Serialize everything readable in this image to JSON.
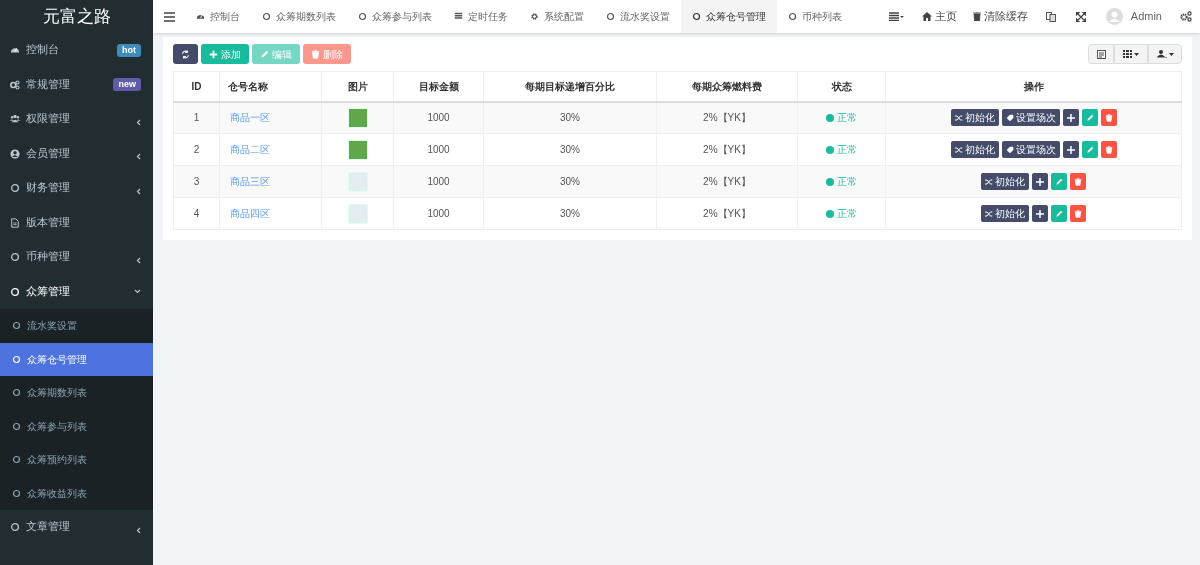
{
  "logo": "元富之路",
  "sidebar": {
    "items": [
      {
        "label": "控制台",
        "kind": "dashboard",
        "badge": {
          "text": "hot",
          "color": "#3c8dbc"
        }
      },
      {
        "label": "常规管理",
        "kind": "cogs",
        "badge": {
          "text": "new",
          "color": "#605ca8"
        }
      },
      {
        "label": "权限管理",
        "kind": "group",
        "expanded": false
      },
      {
        "label": "会员管理",
        "kind": "user",
        "expanded": false
      },
      {
        "label": "财务管理",
        "kind": "circle",
        "expanded": false
      },
      {
        "label": "版本管理",
        "kind": "file"
      },
      {
        "label": "币种管理",
        "kind": "circle",
        "expanded": false
      },
      {
        "label": "众筹管理",
        "kind": "circle",
        "expanded": true,
        "children": [
          {
            "label": "流水奖设置",
            "selected": false
          },
          {
            "label": "众筹仓号管理",
            "selected": true
          },
          {
            "label": "众筹期数列表",
            "selected": false
          },
          {
            "label": "众筹参与列表",
            "selected": false
          },
          {
            "label": "众筹预约列表",
            "selected": false
          },
          {
            "label": "众筹收益列表",
            "selected": false
          }
        ]
      },
      {
        "label": "文章管理",
        "kind": "circle",
        "expanded": false
      }
    ]
  },
  "tabs": [
    {
      "label": "控制台",
      "kind": "dashboard",
      "selected": false
    },
    {
      "label": "众筹期数列表",
      "kind": "circle",
      "selected": false
    },
    {
      "label": "众筹参与列表",
      "kind": "circle",
      "selected": false
    },
    {
      "label": "定时任务",
      "kind": "list",
      "selected": false
    },
    {
      "label": "系统配置",
      "kind": "gear",
      "selected": false
    },
    {
      "label": "流水奖设置",
      "kind": "circle",
      "selected": false
    },
    {
      "label": "众筹仓号管理",
      "kind": "circle",
      "selected": true
    },
    {
      "label": "币种列表",
      "kind": "circle",
      "selected": false
    }
  ],
  "navbar": {
    "home": "主页",
    "clear_cache": "清除缓存",
    "user": "Admin"
  },
  "toolbar": {
    "buttons": [
      {
        "kind": "refresh",
        "disabled": false
      },
      {
        "kind": "add",
        "label": "添加",
        "disabled": false
      },
      {
        "kind": "edit",
        "label": "编辑",
        "disabled": true
      },
      {
        "kind": "delete",
        "label": "删除",
        "disabled": true
      }
    ]
  },
  "table": {
    "columns": [
      "ID",
      "仓号名称",
      "图片",
      "目标金额",
      "每期目标递增百分比",
      "每期众筹燃料费",
      "状态",
      "操作"
    ],
    "rows": [
      {
        "id": "1",
        "name": "商品一区",
        "image": {
          "kind": "photo"
        },
        "target": "1000",
        "increase": "30%",
        "fee": "2%【YK】",
        "status": "正常",
        "actions": [
          {
            "kind": "init",
            "label": "初始化"
          },
          {
            "kind": "session",
            "label": "设置场次"
          },
          {
            "kind": "drag"
          },
          {
            "kind": "edit"
          },
          {
            "kind": "delete"
          }
        ]
      },
      {
        "id": "2",
        "name": "商品二区",
        "image": {
          "kind": "photo"
        },
        "target": "1000",
        "increase": "30%",
        "fee": "2%【YK】",
        "status": "正常",
        "actions": [
          {
            "kind": "init",
            "label": "初始化"
          },
          {
            "kind": "session",
            "label": "设置场次"
          },
          {
            "kind": "drag"
          },
          {
            "kind": "edit"
          },
          {
            "kind": "delete"
          }
        ]
      },
      {
        "id": "3",
        "name": "商品三区",
        "image": {
          "kind": "illustration"
        },
        "target": "1000",
        "increase": "30%",
        "fee": "2%【YK】",
        "status": "正常",
        "actions": [
          {
            "kind": "init",
            "label": "初始化"
          },
          {
            "kind": "drag"
          },
          {
            "kind": "edit"
          },
          {
            "kind": "delete"
          }
        ]
      },
      {
        "id": "4",
        "name": "商品四区",
        "image": {
          "kind": "illustration"
        },
        "target": "1000",
        "increase": "30%",
        "fee": "2%【YK】",
        "status": "正常",
        "actions": [
          {
            "kind": "init",
            "label": "初始化"
          },
          {
            "kind": "drag"
          },
          {
            "kind": "edit"
          },
          {
            "kind": "delete"
          }
        ]
      }
    ]
  }
}
